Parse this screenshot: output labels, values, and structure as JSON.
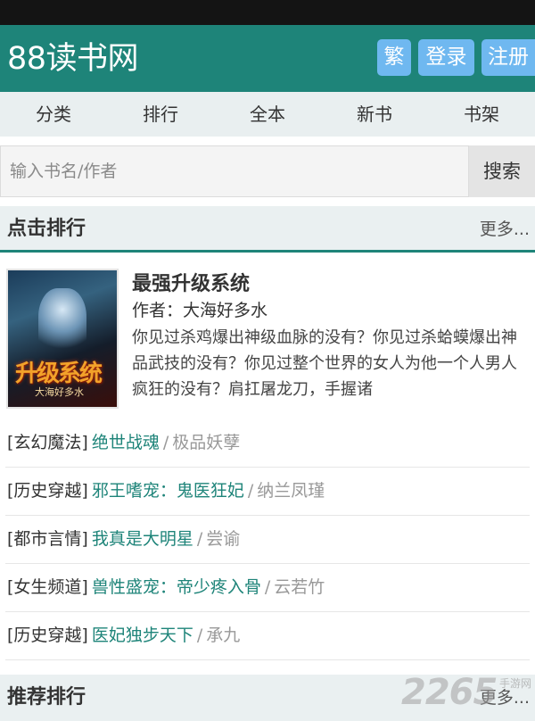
{
  "header": {
    "logo": "88读书网",
    "traditional_label": "繁",
    "login_label": "登录",
    "register_label": "注册"
  },
  "nav": [
    "分类",
    "排行",
    "全本",
    "新书",
    "书架"
  ],
  "search": {
    "placeholder": "输入书名/作者",
    "button_label": "搜索"
  },
  "click_rank": {
    "title": "点击排行",
    "more": "更多...",
    "featured": {
      "cover_art_title": "升级系统",
      "cover_art_author": "大海好多水",
      "title": "最强升级系统",
      "author": "作者：大海好多水",
      "description": "你见过杀鸡爆出神级血脉的没有？你见过杀蛤蟆爆出神品武技的没有？你见过整个世界的女人为他一个人男人疯狂的没有？肩扛屠龙刀，手握诸"
    },
    "items": [
      {
        "category": "[玄幻魔法]",
        "title": "绝世战魂",
        "sep": "/",
        "author": "极品妖孽"
      },
      {
        "category": "[历史穿越]",
        "title": "邪王嗜宠：鬼医狂妃",
        "sep": "/",
        "author": "纳兰凤瑾"
      },
      {
        "category": "[都市言情]",
        "title": "我真是大明星",
        "sep": "/",
        "author": "尝谕"
      },
      {
        "category": "[女生频道]",
        "title": "兽性盛宠：帝少疼入骨",
        "sep": "/",
        "author": "云若竹"
      },
      {
        "category": "[历史穿越]",
        "title": "医妃独步天下",
        "sep": "/",
        "author": "承九"
      }
    ]
  },
  "recommend_rank": {
    "title": "推荐排行",
    "more": "更多..."
  },
  "watermark": {
    "text": "2265",
    "sub": "手游网"
  },
  "colors": {
    "brand": "#1e8479",
    "header_button": "#6fb8f0",
    "nav_bg": "#e9eff0",
    "link": "#1e8479",
    "muted": "#999999"
  }
}
